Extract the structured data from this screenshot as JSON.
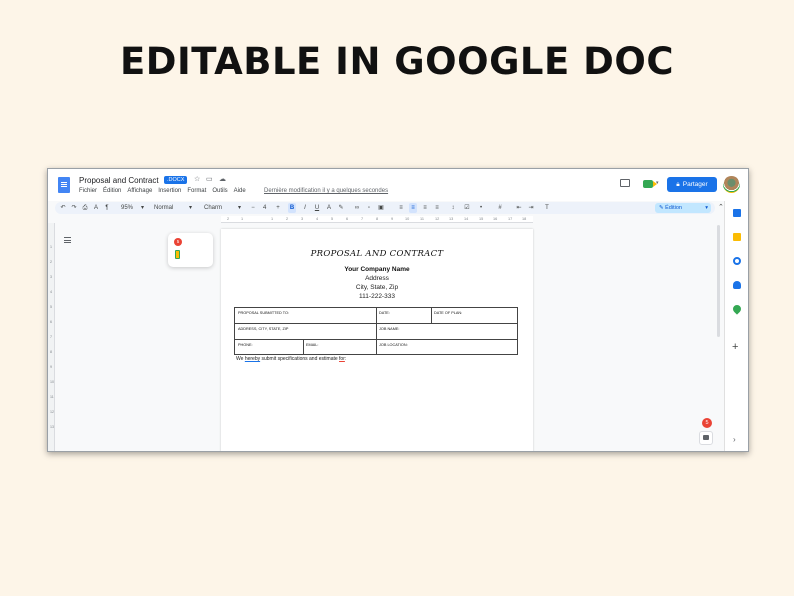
{
  "headline": "EDITABLE IN GOOGLE DOC",
  "app": {
    "doc_title": "Proposal and Contract",
    "file_badge": ".DOCX",
    "menus": [
      "Fichier",
      "Édition",
      "Affichage",
      "Insertion",
      "Format",
      "Outils",
      "Aide"
    ],
    "last_edit": "Dernière modification il y a quelques secondes",
    "share_label": "Partager",
    "share_icon": "lock-icon"
  },
  "toolbar": {
    "zoom": "95%",
    "style": "Normal",
    "font": "Charm",
    "font_size": "4",
    "mode": "Édition"
  },
  "ruler": {
    "h_ticks": [
      "2",
      "1",
      "1",
      "2",
      "3",
      "4",
      "5",
      "6",
      "7",
      "8",
      "9",
      "10",
      "11",
      "12",
      "13",
      "14",
      "15",
      "16",
      "17",
      "18"
    ],
    "v_ticks": [
      "1",
      "2",
      "3",
      "4",
      "5",
      "6",
      "7",
      "8",
      "9",
      "10",
      "11",
      "12",
      "13"
    ]
  },
  "floating_card": {
    "badge": "5"
  },
  "notification_count": "5",
  "document": {
    "title": "PROPOSAL AND CONTRACT",
    "company": "Your Company Name",
    "address": "Address",
    "city_state_zip": "City, State, Zip",
    "phone": "111-222-333",
    "form": {
      "proposal_submitted_to": "PROPOSAL SUBMITTED TO:",
      "date": "DATE:",
      "date_of_plan": "DATE OF PLAN:",
      "address": "ADDRESS, CITY, STATE, ZIP",
      "job_name": "JOB NAME:",
      "phone": "PHONE:",
      "email": "EMAIL:",
      "job_location": "JOB LOCATION:"
    },
    "note_pre": "We ",
    "note_hereby": "hereby",
    "note_mid": " submit specifications and estimate ",
    "note_for": "for",
    "note_end": ":"
  }
}
